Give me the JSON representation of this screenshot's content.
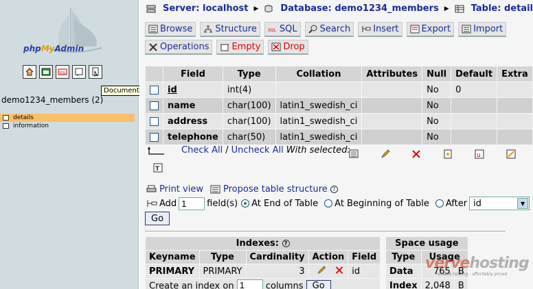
{
  "logo": {
    "brand_left": "php",
    "brand_mid": "My",
    "brand_right": "Admin"
  },
  "left_icons": [
    "home-icon",
    "query-window-icon",
    "sql-icon",
    "query-icon",
    "documentation-icon"
  ],
  "tooltip": "Documentation",
  "left": {
    "db_label": "demo1234_members (2)",
    "tables": [
      {
        "name": "details",
        "selected": true
      },
      {
        "name": "information",
        "selected": false
      }
    ]
  },
  "breadcrumb": {
    "server": "Server: localhost",
    "database": "Database: demo1234_members",
    "table": "Table: details"
  },
  "tabs": {
    "browse": "Browse",
    "structure": "Structure",
    "sql": "SQL",
    "search": "Search",
    "insert": "Insert",
    "export": "Export",
    "import": "Import",
    "operations": "Operations",
    "empty": "Empty",
    "drop": "Drop"
  },
  "fields_table": {
    "headers": [
      "Field",
      "Type",
      "Collation",
      "Attributes",
      "Null",
      "Default",
      "Extra"
    ],
    "rows": [
      {
        "field": "id",
        "type": "int(4)",
        "collation": "",
        "attributes": "",
        "null": "No",
        "default": "0",
        "extra": ""
      },
      {
        "field": "name",
        "type": "char(100)",
        "collation": "latin1_swedish_ci",
        "attributes": "",
        "null": "No",
        "default": "",
        "extra": ""
      },
      {
        "field": "address",
        "type": "char(100)",
        "collation": "latin1_swedish_ci",
        "attributes": "",
        "null": "No",
        "default": "",
        "extra": ""
      },
      {
        "field": "telephone",
        "type": "char(50)",
        "collation": "latin1_swedish_ci",
        "attributes": "",
        "null": "No",
        "default": "",
        "extra": ""
      }
    ]
  },
  "with_selected": {
    "check_all": "Check All",
    "sep": "/",
    "uncheck_all": "Uncheck All",
    "label": "With selected:"
  },
  "links": {
    "print_view": "Print view",
    "propose": "Propose table structure"
  },
  "add_field": {
    "add_label": "Add",
    "count": "1",
    "fields_label": "field(s)",
    "at_end": "At End of Table",
    "at_beginning": "At Beginning of Table",
    "after": "After",
    "after_value": "id",
    "go": "Go"
  },
  "indexes": {
    "title": "Indexes:",
    "headers": [
      "Keyname",
      "Type",
      "Cardinality",
      "Action",
      "Field"
    ],
    "row": {
      "keyname": "PRIMARY",
      "type": "PRIMARY",
      "cardinality": "3",
      "field": "id"
    },
    "create_label": "Create an index on",
    "create_count": "1",
    "create_suffix": "columns",
    "go": "Go"
  },
  "space": {
    "title": "Space usage",
    "headers": [
      "Type",
      "Usage"
    ],
    "rows": [
      {
        "type": "Data",
        "usage": "765",
        "unit": "B"
      },
      {
        "type": "Index",
        "usage": "2,048",
        "unit": "B"
      }
    ]
  },
  "watermark": {
    "part1": "verve",
    "part2": "hosting",
    "tagline": "reliable hosting - affordably priced"
  },
  "colors": {
    "link": "#1a2a9a",
    "danger": "#d00000",
    "selected_table": "#f9c06a",
    "left_bg": "#d0dce0"
  }
}
